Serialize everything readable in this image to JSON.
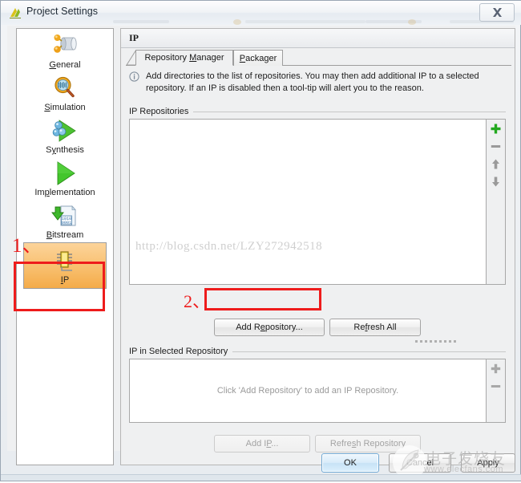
{
  "window": {
    "title": "Project Settings",
    "title_icon": "vivado-logo-icon",
    "close_icon": "close-icon"
  },
  "sidebar": {
    "items": [
      {
        "id": "general",
        "label": "General",
        "accel": "G",
        "icon": "general-icon",
        "selected": false
      },
      {
        "id": "simulation",
        "label": "Simulation",
        "accel": "S",
        "icon": "simulation-icon",
        "selected": false
      },
      {
        "id": "synthesis",
        "label": "Synthesis",
        "accel": "y",
        "icon": "synthesis-icon",
        "selected": false
      },
      {
        "id": "implementation",
        "label": "Implementation",
        "accel": "p",
        "icon": "implementation-icon",
        "selected": false
      },
      {
        "id": "bitstream",
        "label": "Bitstream",
        "accel": "B",
        "icon": "bitstream-icon",
        "selected": false
      },
      {
        "id": "ip",
        "label": "IP",
        "accel": "I",
        "icon": "ip-icon",
        "selected": true
      }
    ]
  },
  "content": {
    "title": "IP",
    "tabs": [
      {
        "id": "repository-manager",
        "label": "Repository Manager",
        "accel": "M",
        "active": true
      },
      {
        "id": "packager",
        "label": "Packager",
        "accel": "P",
        "active": false
      }
    ],
    "info": {
      "icon": "info-icon",
      "text": "Add directories to the list of repositories. You may then add additional IP to a selected repository. If an IP is disabled then a tool-tip will alert you to the reason."
    },
    "repositories": {
      "label": "IP Repositories",
      "items": [],
      "empty_text": "",
      "side_buttons": [
        {
          "id": "add",
          "icon": "plus-icon",
          "enabled": true
        },
        {
          "id": "remove",
          "icon": "minus-icon",
          "enabled": false
        },
        {
          "id": "move-up",
          "icon": "arrow-up-icon",
          "enabled": false
        },
        {
          "id": "move-down",
          "icon": "arrow-down-icon",
          "enabled": false
        }
      ],
      "buttons": [
        {
          "id": "add-repository",
          "label": "Add Repository...",
          "accel": "e",
          "enabled": true
        },
        {
          "id": "refresh-all",
          "label": "Refresh All",
          "accel": "f",
          "enabled": true
        }
      ]
    },
    "selected_repository": {
      "label": "IP in Selected Repository",
      "empty_text": "Click 'Add Repository' to add an IP Repository.",
      "side_buttons": [
        {
          "id": "add-ip-side",
          "icon": "plus-icon",
          "enabled": false
        },
        {
          "id": "remove-ip-side",
          "icon": "minus-icon",
          "enabled": false
        }
      ],
      "buttons": [
        {
          "id": "add-ip",
          "label": "Add IP...",
          "accel": "P",
          "enabled": false
        },
        {
          "id": "refresh-repository",
          "label": "Refresh Repository",
          "accel": "s",
          "enabled": false
        }
      ]
    }
  },
  "footer": {
    "buttons": [
      {
        "id": "ok",
        "label": "OK",
        "default": true
      },
      {
        "id": "cancel",
        "label": "Cancel",
        "default": false
      },
      {
        "id": "apply",
        "label": "Apply",
        "default": false
      }
    ]
  },
  "watermarks": {
    "blog_url": "http://blog.csdn.net/LZY272942518",
    "site_cn": "电子发烧友",
    "site_url": "www.elecfans.com"
  },
  "annotations": [
    {
      "id": "step-1",
      "text": "1、",
      "target": "sidebar-item-ip"
    },
    {
      "id": "step-2",
      "text": "2、",
      "target": "add-repository-button"
    }
  ],
  "colors": {
    "annotation_red": "#ee1c1c",
    "selected_item_orange": "#f4ab49",
    "accent_green": "#22a81e",
    "default_button_blue": "#6fa8d4"
  }
}
